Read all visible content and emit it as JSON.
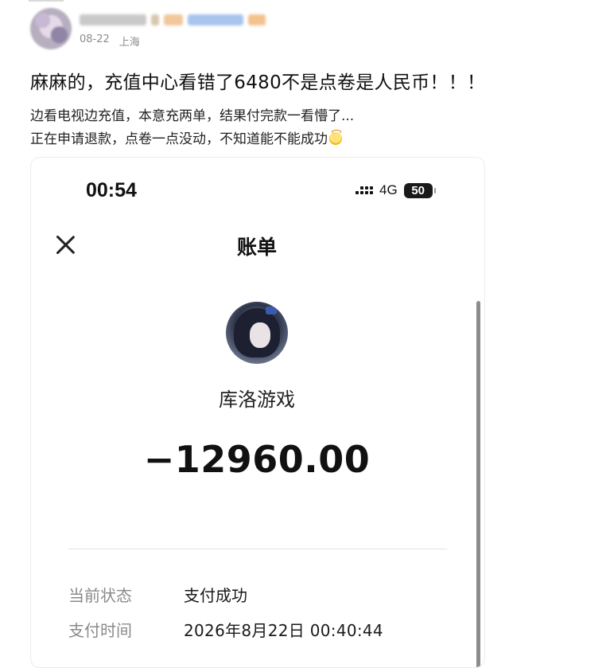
{
  "post": {
    "date": "08-22",
    "location": "上海",
    "title": "麻麻的，充值中心看错了6480不是点卷是人民币！！！",
    "line1": "边看电视边充值，本意充两单，结果付完款一看懵了...",
    "line2": "正在申请退款，点卷一点没动，不知道能不能成功"
  },
  "screenshot": {
    "status_bar": {
      "time": "00:54",
      "network": "4G",
      "battery": "50"
    },
    "nav": {
      "title": "账单"
    },
    "merchant": {
      "name": "库洛游戏"
    },
    "amount": "−12960.00",
    "details": [
      {
        "label": "当前状态",
        "value": "支付成功"
      },
      {
        "label": "支付时间",
        "value": "2026年8月22日 00:40:44"
      }
    ]
  },
  "icons": {
    "close": "close-icon",
    "signal": "signal-dots-icon",
    "battery": "battery-icon",
    "emoji": "face-emoji-icon"
  },
  "colors": {
    "label_gray": "#8a8a8a",
    "meta_gray": "#8c8c8c",
    "text": "#111111"
  }
}
